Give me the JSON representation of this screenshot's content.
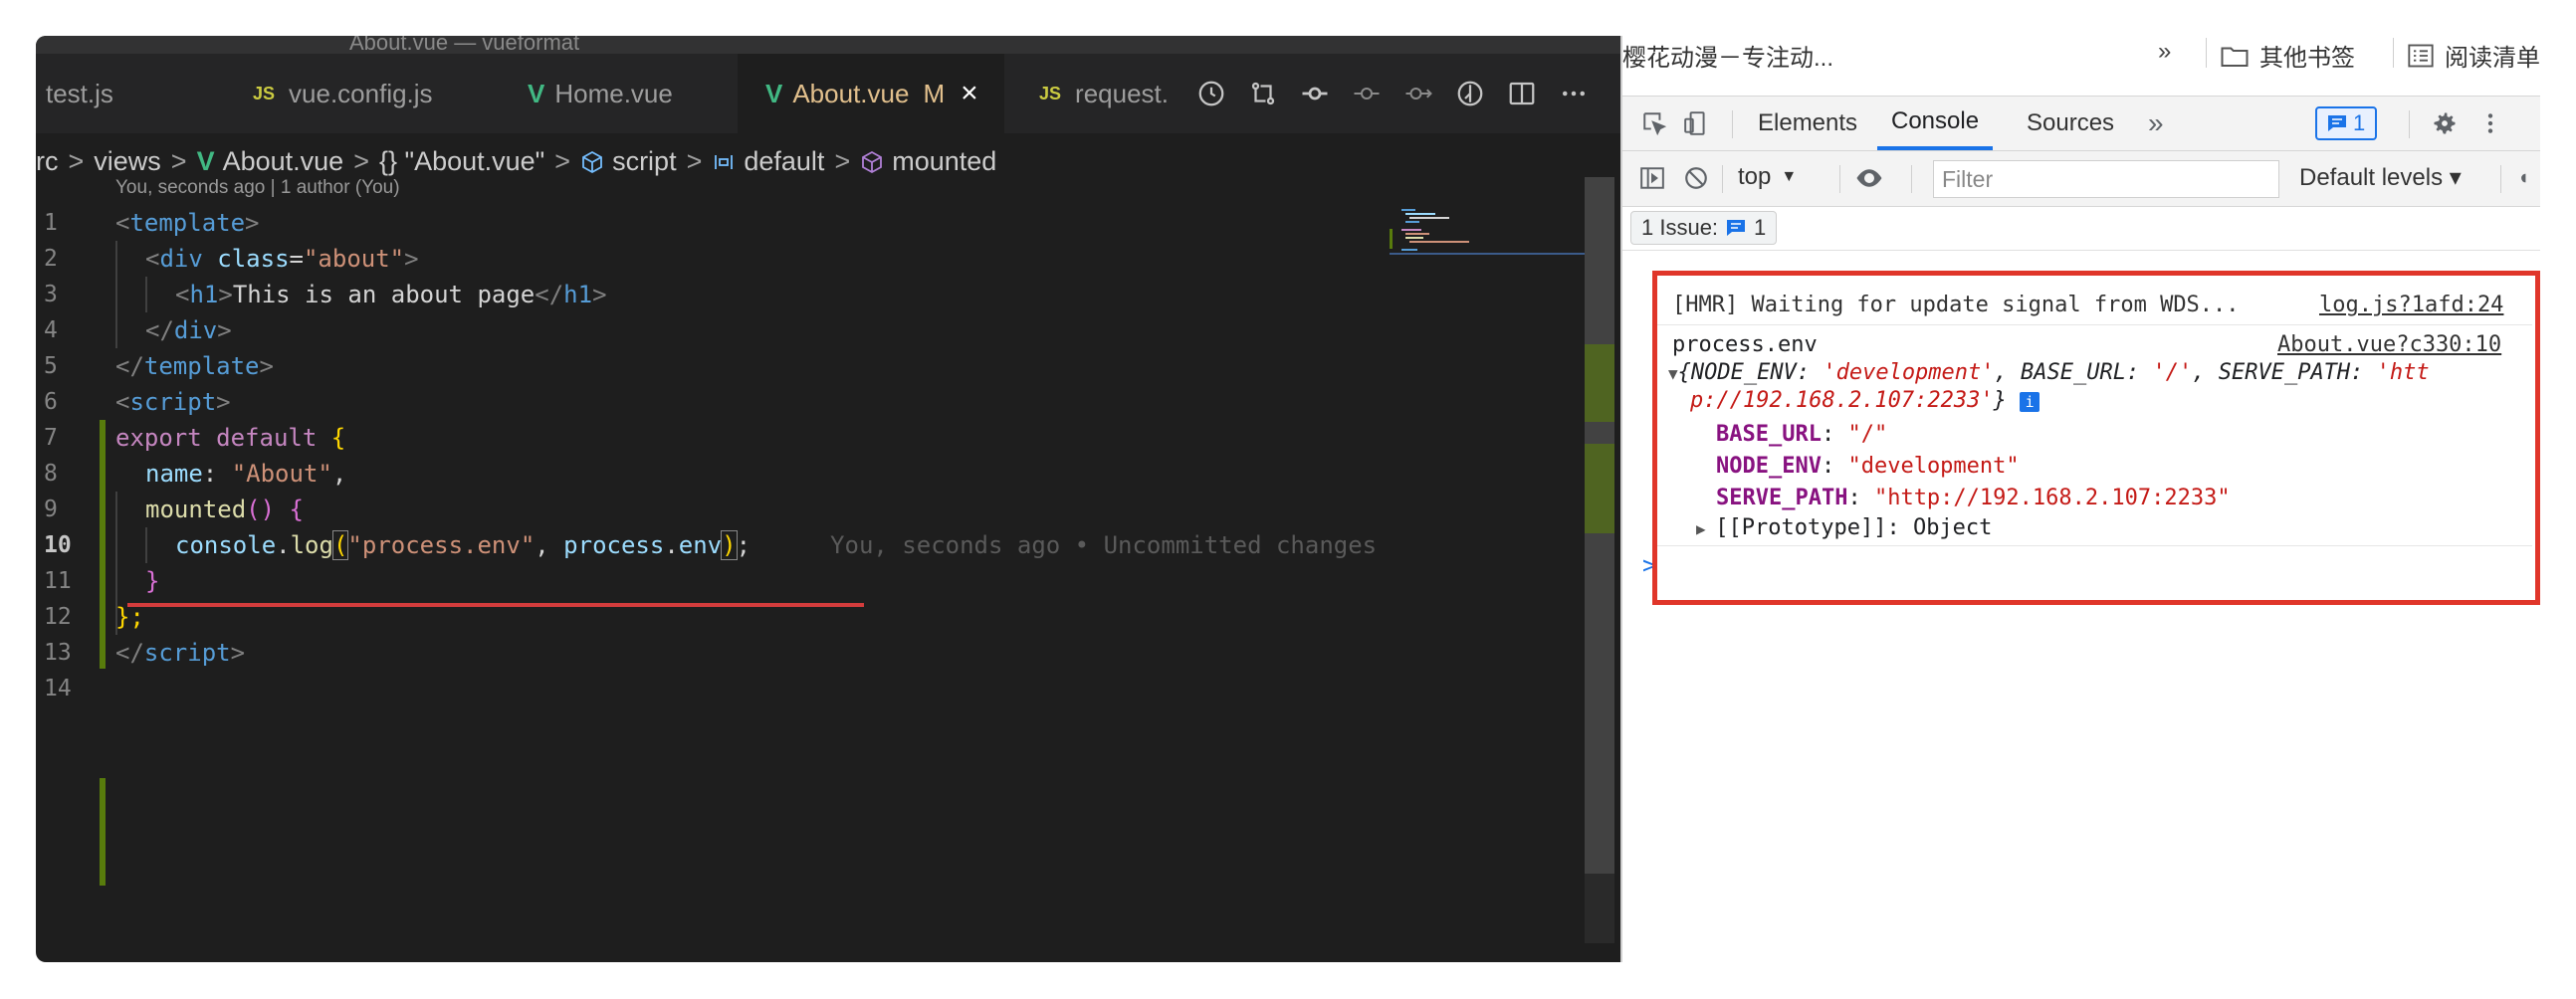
{
  "vscode": {
    "window_title": "About.vue — vueformat",
    "tabs": [
      {
        "badge": "",
        "label": "test.js"
      },
      {
        "badge": "JS",
        "label": "vue.config.js"
      },
      {
        "badge": "V",
        "label": "Home.vue"
      },
      {
        "badge": "V",
        "label": "About.vue",
        "modified": "M",
        "close": "×"
      },
      {
        "badge": "JS",
        "label": "request."
      }
    ],
    "tab_action_icons": [
      "history-icon",
      "compare-changes-icon",
      "git-commit-icon",
      "previous-change-icon",
      "next-change-icon",
      "timeline-icon",
      "split-editor-icon",
      "more-actions-icon"
    ],
    "breadcrumb": {
      "items": [
        "rc",
        "views",
        "About.vue",
        "{} \"About.vue\"",
        "script",
        "default",
        "mounted"
      ],
      "separator": ">"
    },
    "codelens": "You, seconds ago | 1 author (You)",
    "lines": [
      {
        "n": "1"
      },
      {
        "n": "2"
      },
      {
        "n": "3"
      },
      {
        "n": "4"
      },
      {
        "n": "5"
      },
      {
        "n": "6"
      },
      {
        "n": "7"
      },
      {
        "n": "8"
      },
      {
        "n": "9"
      },
      {
        "n": "10"
      },
      {
        "n": "11"
      },
      {
        "n": "12"
      },
      {
        "n": "13"
      },
      {
        "n": "14"
      }
    ],
    "code": {
      "l1_tag": "template",
      "l2_tag": "div",
      "l2_attr": "class",
      "l2_val": "\"about\"",
      "l3_tag": "h1",
      "l3_text": "This is an about page",
      "l4_tag": "div",
      "l5_tag": "template",
      "l6_tag": "script",
      "l7_kw": "export default",
      "l7_brace": "{",
      "l8_prop": "name",
      "l8_val": "\"About\"",
      "l9_fn": "mounted",
      "l9_parens": "()",
      "l9_brace": "{",
      "l10_obj": "console",
      "l10_fn": "log",
      "l10_str": "\"process.env\"",
      "l10_var1": "process",
      "l10_var2": "env",
      "l10_ghost": "You, seconds ago • Uncommitted changes",
      "l11_brace": "}",
      "l12_brace": "};",
      "l13_tag": "script"
    },
    "colors": {
      "gutter_added": "#587c0c",
      "error_underline": "#d43c3c",
      "vue_green": "#41b883"
    }
  },
  "browser": {
    "bookmarks": {
      "site": "樱花动漫－专注动...",
      "more": "»",
      "folder": "其他书签",
      "reading_list": "阅读清单"
    },
    "devtools": {
      "tabs": [
        "Elements",
        "Console",
        "Sources"
      ],
      "active_tab": "Console",
      "more_tabs": "»",
      "issues_badge": "1",
      "context": "top",
      "filter_placeholder": "Filter",
      "levels": "Default levels ▾",
      "issue_bar": {
        "label": "1 Issue:",
        "count": "1"
      }
    },
    "console": {
      "hmr_text": "[HMR] Waiting for update signal from WDS...",
      "hmr_source": "log.js?1afd:24",
      "log_label": "process.env",
      "log_source": "About.vue?c330:10",
      "summary_line1_pre": "{NODE_ENV: ",
      "summary_v1": "'development'",
      "summary_mid1": ", BASE_URL: ",
      "summary_v2": "'/'",
      "summary_mid2": ", SERVE_PATH: ",
      "summary_v3a": "'htt",
      "summary_v3b": "p://192.168.2.107:2233'",
      "summary_close": "}",
      "info_icon": "i",
      "props": [
        {
          "key": "BASE_URL",
          "value": "\"/\""
        },
        {
          "key": "NODE_ENV",
          "value": "\"development\""
        },
        {
          "key": "SERVE_PATH",
          "value": "\"http://192.168.2.107:2233\""
        }
      ],
      "prototype": "[[Prototype]]: Object",
      "prompt": ">"
    },
    "highlight_color": "#e0362a"
  }
}
